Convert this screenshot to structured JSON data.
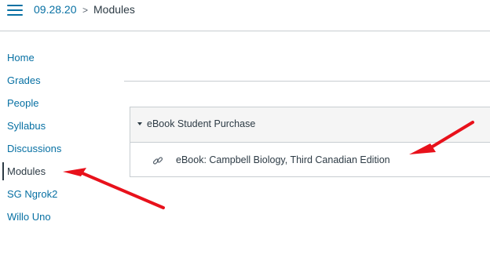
{
  "header": {
    "menu_icon": "hamburger-menu-icon",
    "breadcrumb": {
      "course": "09.28.20",
      "separator": ">",
      "current": "Modules"
    }
  },
  "sidebar": {
    "items": [
      {
        "label": "Home",
        "active": false
      },
      {
        "label": "Grades",
        "active": false
      },
      {
        "label": "People",
        "active": false
      },
      {
        "label": "Syllabus",
        "active": false
      },
      {
        "label": "Discussions",
        "active": false
      },
      {
        "label": "Modules",
        "active": true
      },
      {
        "label": "SG Ngrok2",
        "active": false
      },
      {
        "label": "Willo Uno",
        "active": false
      }
    ]
  },
  "module": {
    "title": "eBook Student Purchase",
    "collapse_icon": "caret-down-icon",
    "items": [
      {
        "icon": "link-icon",
        "title": "eBook: Campbell Biology, Third Canadian Edition"
      }
    ]
  },
  "colors": {
    "link": "#0770a3",
    "text": "#2d3b45",
    "border": "#c7cdd1",
    "module_header_bg": "#f5f5f5",
    "annotation_arrow": "#e8111b"
  }
}
